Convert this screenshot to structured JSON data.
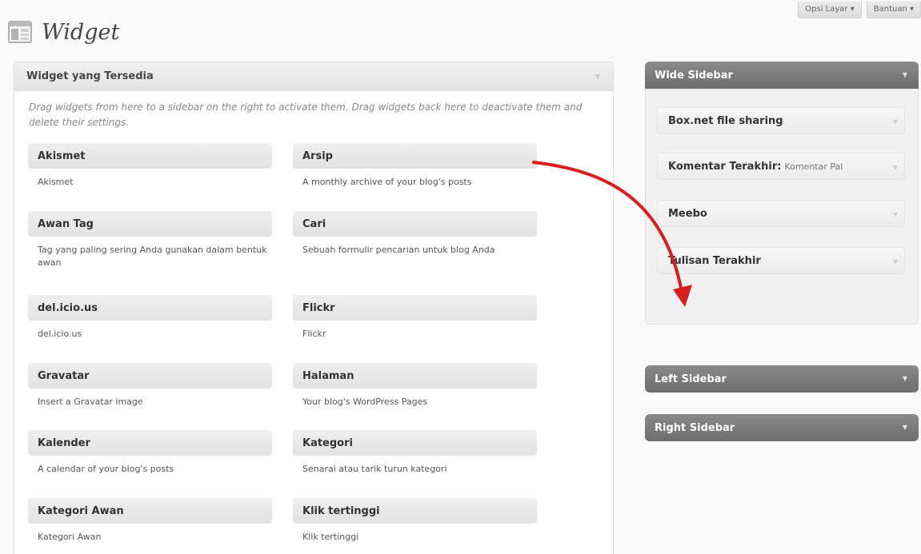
{
  "header": {
    "title": "Widget",
    "screen_options": "Opsi Layar ▾",
    "help": "Bantuan ▾"
  },
  "available": {
    "title": "Widget yang Tersedia",
    "description": "Drag widgets from here to a sidebar on the right to activate them. Drag widgets back here to deactivate them and delete their settings.",
    "widgets": [
      {
        "name": "Akismet",
        "desc": "Akismet"
      },
      {
        "name": "Arsip",
        "desc": "A monthly archive of your blog's posts"
      },
      {
        "name": "Awan Tag",
        "desc": "Tag yang paling sering Anda gunakan dalam bentuk awan"
      },
      {
        "name": "Cari",
        "desc": "Sebuah formulir pencarian untuk blog Anda"
      },
      {
        "name": "del.icio.us",
        "desc": "del.icio.us"
      },
      {
        "name": "Flickr",
        "desc": "Flickr"
      },
      {
        "name": "Gravatar",
        "desc": "Insert a Gravatar image"
      },
      {
        "name": "Halaman",
        "desc": "Your blog's WordPress Pages"
      },
      {
        "name": "Kalender",
        "desc": "A calendar of your blog's posts"
      },
      {
        "name": "Kategori",
        "desc": "Senarai atau tarik turun kategori"
      },
      {
        "name": "Kategori Awan",
        "desc": "Kategori Awan"
      },
      {
        "name": "Klik tertinggi",
        "desc": "Klik tertinggi"
      }
    ]
  },
  "sidebars": {
    "wide": {
      "title": "Wide Sidebar",
      "widgets": [
        {
          "name": "Box.net file sharing",
          "subtitle": ""
        },
        {
          "name": "Komentar Terakhir:",
          "subtitle": "Komentar Pal"
        },
        {
          "name": "Meebo",
          "subtitle": ""
        },
        {
          "name": "Tulisan Terakhir",
          "subtitle": ""
        }
      ]
    },
    "left": {
      "title": "Left Sidebar"
    },
    "right": {
      "title": "Right Sidebar"
    }
  },
  "colors": {
    "arrow": "#d81e1e",
    "sidebar_header": "#7a7a7a"
  },
  "icons": {
    "page_icon": "widgets-icon",
    "toggle": "triangle-down-icon"
  }
}
